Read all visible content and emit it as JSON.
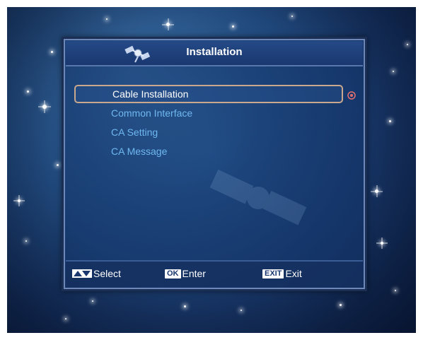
{
  "window": {
    "title": "Installation",
    "title_icon": "satellite-icon"
  },
  "menu": {
    "items": [
      {
        "label": "Cable Installation",
        "selected": true
      },
      {
        "label": "Common Interface",
        "selected": false
      },
      {
        "label": "CA Setting",
        "selected": false
      },
      {
        "label": "CA Message",
        "selected": false
      }
    ],
    "pointer_icon": "selection-dot-icon"
  },
  "footer": {
    "select": {
      "key": "up-down-arrows-icon",
      "label": "Select"
    },
    "enter": {
      "key": "OK",
      "label": "Enter"
    },
    "exit": {
      "key": "EXIT",
      "label": "Exit"
    }
  },
  "colors": {
    "selected_text": "#ffffff",
    "item_text": "#6fb8f0",
    "highlight_border": "#c9a88d",
    "window_border": "#1b2f55"
  }
}
